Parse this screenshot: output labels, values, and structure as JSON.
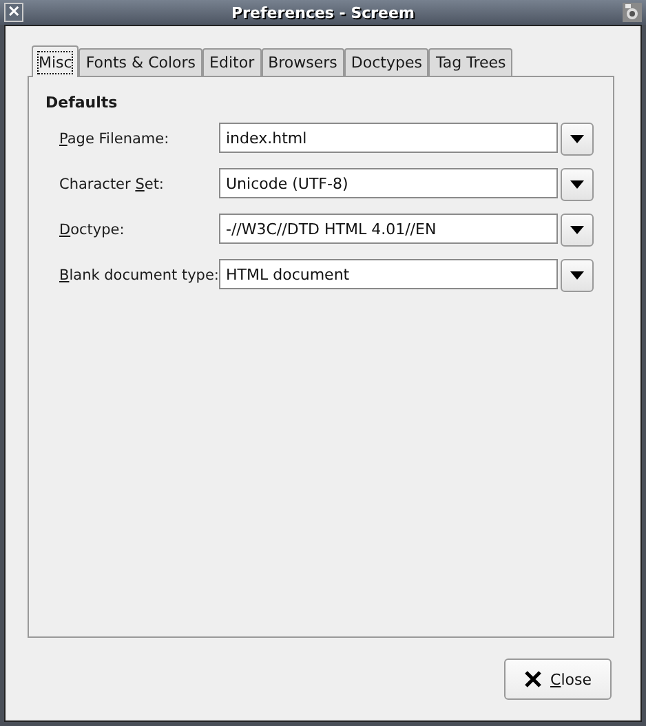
{
  "window": {
    "title": "Preferences - Screem",
    "close_glyph": "✕"
  },
  "tabs": [
    {
      "label": "Misc",
      "selected": true
    },
    {
      "label": "Fonts & Colors",
      "selected": false
    },
    {
      "label": "Editor",
      "selected": false
    },
    {
      "label": "Browsers",
      "selected": false
    },
    {
      "label": "Doctypes",
      "selected": false
    },
    {
      "label": "Tag Trees",
      "selected": false
    }
  ],
  "section": {
    "title": "Defaults"
  },
  "fields": [
    {
      "key": "P",
      "post": "age Filename:",
      "value": "index.html"
    },
    {
      "pre": "Character ",
      "key": "S",
      "post": "et:",
      "value": "Unicode (UTF-8)"
    },
    {
      "key": "D",
      "post": "octype:",
      "value": "-//W3C//DTD HTML 4.01//EN"
    },
    {
      "key": "B",
      "post": "lank document type:",
      "value": "HTML document"
    }
  ],
  "close_button": {
    "key": "C",
    "post": "lose"
  }
}
